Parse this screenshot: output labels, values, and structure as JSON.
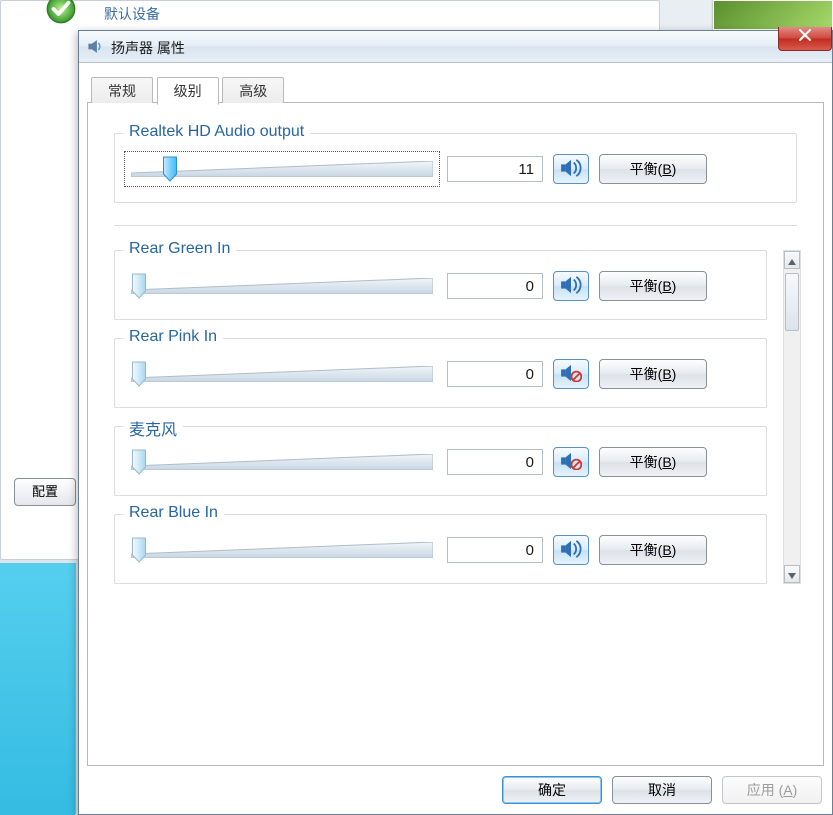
{
  "background": {
    "default_device": "默认设备",
    "configure_btn": "配置"
  },
  "dialog": {
    "title": "扬声器 属性",
    "tabs": {
      "general": "常规",
      "levels": "级别",
      "advanced": "高级"
    },
    "balance_label": "平衡",
    "balance_key": "B",
    "main": {
      "name": "Realtek HD Audio output",
      "value": "11",
      "muted": false
    },
    "inputs": [
      {
        "name": "Rear Green In",
        "value": "0",
        "muted": false
      },
      {
        "name": "Rear Pink In",
        "value": "0",
        "muted": true
      },
      {
        "name": "麦克风",
        "value": "0",
        "muted": true
      },
      {
        "name": "Rear Blue In",
        "value": "0",
        "muted": false
      }
    ],
    "buttons": {
      "ok": "确定",
      "cancel": "取消",
      "apply": "应用",
      "apply_key": "A"
    }
  }
}
